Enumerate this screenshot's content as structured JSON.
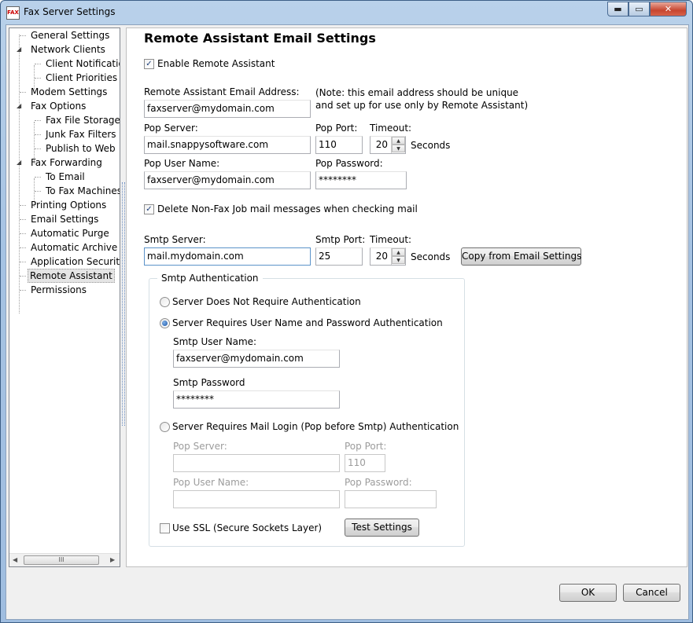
{
  "window": {
    "title": "Fax Server Settings",
    "app_icon_text": "FAX",
    "minimize_icon": "▬",
    "maximize_icon": "▭",
    "close_icon": "✕"
  },
  "tree": {
    "items": [
      {
        "label": "General Settings",
        "level": 0
      },
      {
        "label": "Network Clients",
        "level": 0,
        "expanded": true
      },
      {
        "label": "Client Notifications",
        "level": 1
      },
      {
        "label": "Client Priorities",
        "level": 1
      },
      {
        "label": "Modem Settings",
        "level": 0
      },
      {
        "label": "Fax Options",
        "level": 0,
        "expanded": true
      },
      {
        "label": "Fax File Storage",
        "level": 1
      },
      {
        "label": "Junk Fax Filters",
        "level": 1
      },
      {
        "label": "Publish to Web",
        "level": 1
      },
      {
        "label": "Fax Forwarding",
        "level": 0,
        "expanded": true
      },
      {
        "label": "To Email",
        "level": 1
      },
      {
        "label": "To Fax Machines",
        "level": 1
      },
      {
        "label": "Printing Options",
        "level": 0
      },
      {
        "label": "Email Settings",
        "level": 0
      },
      {
        "label": "Automatic Purge",
        "level": 0
      },
      {
        "label": "Automatic Archive",
        "level": 0
      },
      {
        "label": "Application Security",
        "level": 0
      },
      {
        "label": "Remote Assistant",
        "level": 0,
        "selected": true
      },
      {
        "label": "Permissions",
        "level": 0
      }
    ],
    "scroll_left": "◀",
    "scroll_right": "▶",
    "scroll_grip": "III"
  },
  "panel": {
    "heading": "Remote Assistant Email Settings",
    "enable_label": "Enable Remote Assistant",
    "enable_checked": "✓",
    "email_address_label": "Remote Assistant Email Address:",
    "email_address_value": "faxserver@mydomain.com",
    "note_line1": "(Note: this email address should be unique",
    "note_line2": "and set up for use only by Remote Assistant)",
    "pop_server_label": "Pop Server:",
    "pop_server_value": "mail.snappysoftware.com",
    "pop_port_label": "Pop Port:",
    "pop_port_value": "110",
    "pop_timeout_label": "Timeout:",
    "pop_timeout_value": "20",
    "pop_seconds_label": "Seconds",
    "pop_user_label": "Pop User Name:",
    "pop_user_value": "faxserver@mydomain.com",
    "pop_password_label": "Pop Password:",
    "pop_password_value": "********",
    "delete_label": "Delete Non-Fax Job mail messages when checking mail",
    "delete_checked": "✓",
    "smtp_server_label": "Smtp Server:",
    "smtp_server_value": "mail.mydomain.com",
    "smtp_port_label": "Smtp Port:",
    "smtp_port_value": "25",
    "smtp_timeout_label": "Timeout:",
    "smtp_timeout_value": "20",
    "smtp_seconds_label": "Seconds",
    "copy_button": "Copy from Email Settings",
    "spin_up": "▲",
    "spin_down": "▼"
  },
  "auth": {
    "group_title": "Smtp Authentication",
    "option_none": "Server Does Not Require Authentication",
    "option_user_pass": "Server Requires User Name and Password Authentication",
    "smtp_user_label": "Smtp User Name:",
    "smtp_user_value": "faxserver@mydomain.com",
    "smtp_password_label": "Smtp Password",
    "smtp_password_value": "********",
    "option_pop_before": "Server Requires Mail Login (Pop before Smtp) Authentication",
    "pb_pop_server_label": "Pop Server:",
    "pb_pop_server_value": "",
    "pb_pop_port_label": "Pop Port:",
    "pb_pop_port_value": "110",
    "pb_pop_user_label": "Pop User Name:",
    "pb_pop_user_value": "",
    "pb_pop_password_label": "Pop Password:",
    "pb_pop_password_value": "",
    "ssl_label": "Use SSL (Secure Sockets Layer)",
    "test_button": "Test Settings"
  },
  "footer": {
    "ok_button": "OK",
    "cancel_button": "Cancel"
  }
}
